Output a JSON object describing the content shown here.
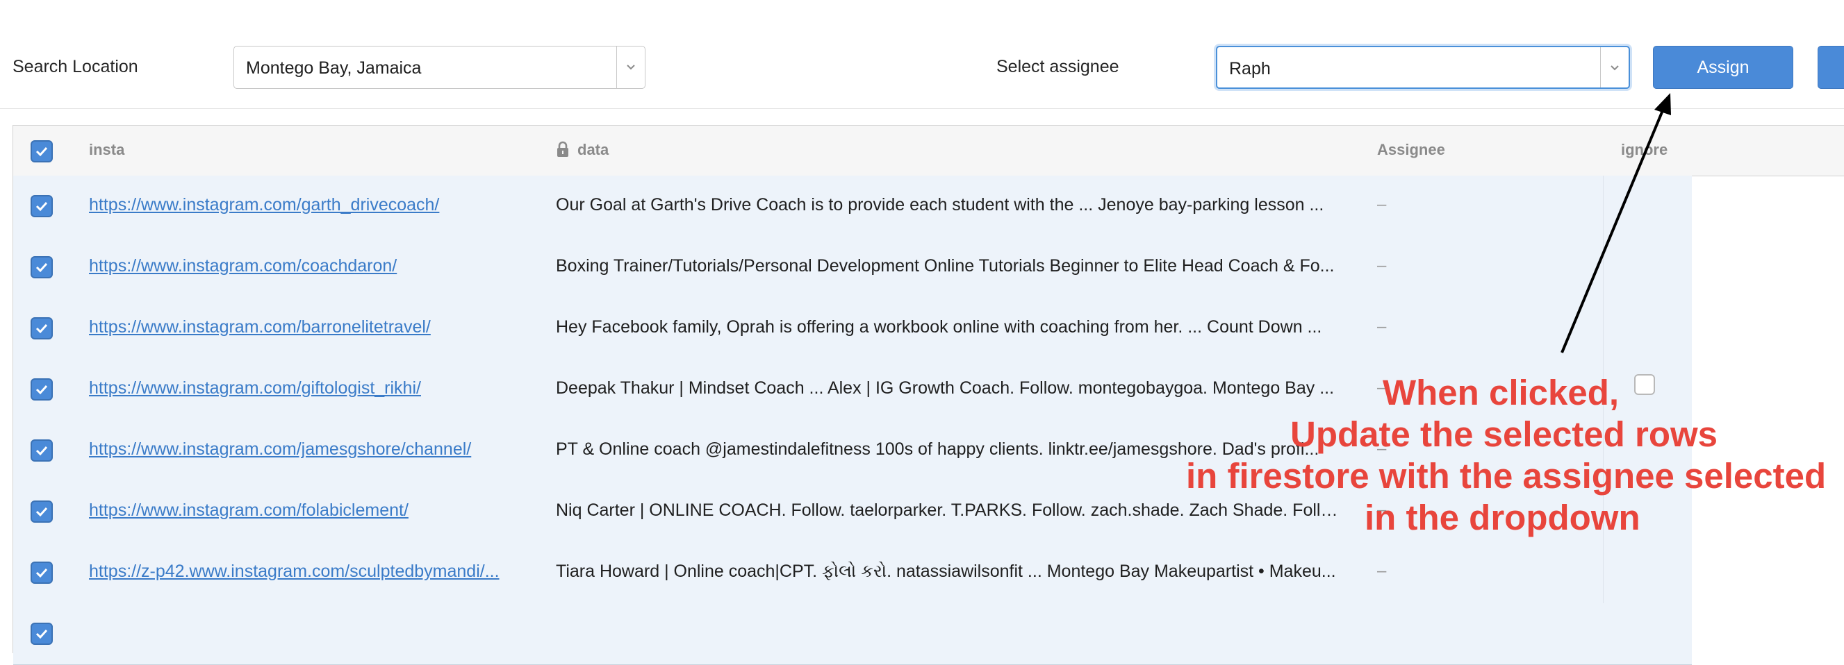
{
  "toolbar": {
    "search_label": "Search Location",
    "location_value": "Montego Bay, Jamaica",
    "assignee_label": "Select assignee",
    "assignee_value": "Raph",
    "assign_button": "Assign"
  },
  "table": {
    "headers": {
      "insta": "insta",
      "data": "data",
      "assignee": "Assignee",
      "ignore": "ignore"
    },
    "rows": [
      {
        "insta": "https://www.instagram.com/garth_drivecoach/",
        "data": "Our Goal at Garth's Drive Coach is to provide each student with the ... Jenoye bay-parking lesson ...",
        "assignee": "–"
      },
      {
        "insta": "https://www.instagram.com/coachdaron/",
        "data": "Boxing Trainer/Tutorials/Personal Development Online Tutorials Beginner to Elite Head Coach & Fo...",
        "assignee": "–"
      },
      {
        "insta": "https://www.instagram.com/barronelitetravel/",
        "data": "Hey Facebook family, Oprah is offering a workbook online with coaching from her. ... Count Down ...",
        "assignee": "–"
      },
      {
        "insta": "https://www.instagram.com/giftologist_rikhi/",
        "data": "Deepak Thakur | Mindset Coach ... Alex | IG Growth Coach. Follow. montegobaygoa. Montego Bay ...",
        "assignee": "–"
      },
      {
        "insta": "https://www.instagram.com/jamesgshore/channel/",
        "data": "PT & Online coach @jamestindalefitness 100s of happy clients. linktr.ee/jamesgshore. Dad's profi...",
        "assignee": "–"
      },
      {
        "insta": "https://www.instagram.com/folabiclement/",
        "data": "Niq Carter | ONLINE COACH. Follow. taelorparker. T.PARKS. Follow. zach.shade. Zach Shade. Follo...",
        "assignee": "–"
      },
      {
        "insta": "https://z-p42.www.instagram.com/sculptedbymandi/...",
        "data": "Tiara Howard | Online coach|CPT. ફોલો કરો. natassiawilsonfit ... Montego Bay Makeupartist • Makeu...",
        "assignee": "–"
      }
    ]
  },
  "annotation": {
    "lines": [
      "When clicked,",
      "Update the selected rows",
      "in firestore with the assignee selected",
      "in the dropdown"
    ],
    "color": "#e8453c"
  },
  "colors": {
    "accent": "#4a8ad8",
    "row_selected": "#edf3fa",
    "link": "#3a7bc8"
  },
  "icons": [
    "chevron-down-icon",
    "lock-icon",
    "check-icon",
    "arrow-icon"
  ]
}
